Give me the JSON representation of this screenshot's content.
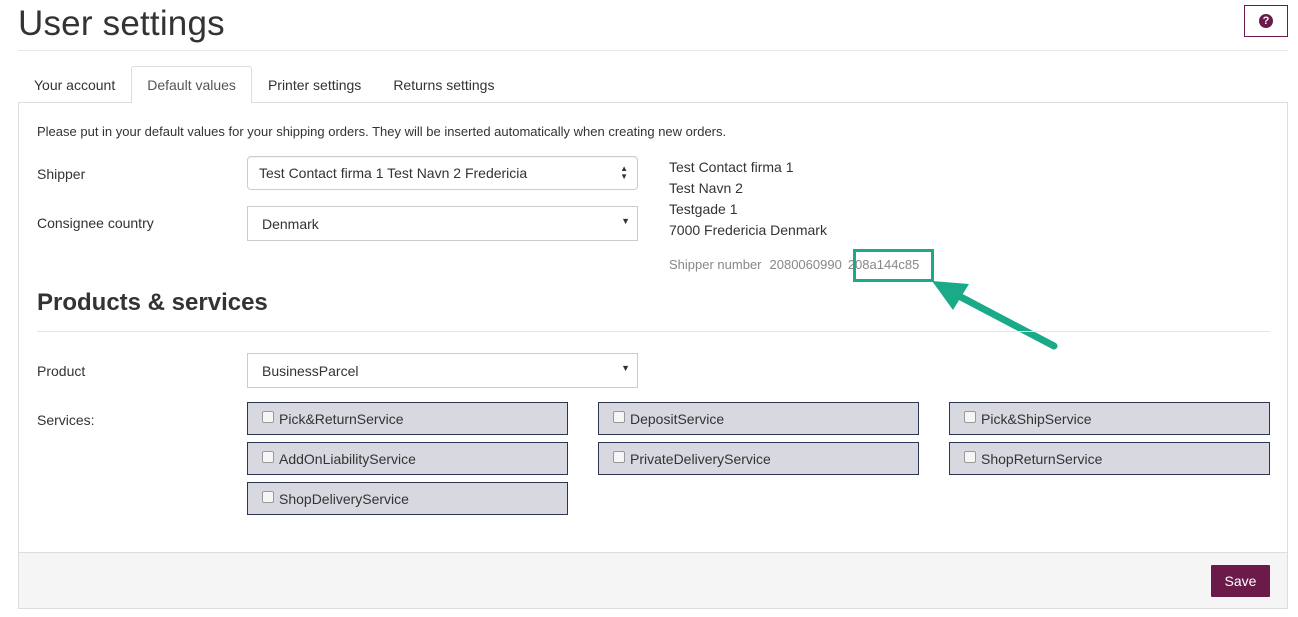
{
  "page": {
    "title": "User settings"
  },
  "help": {
    "icon": "question-circle-icon",
    "glyph": "?"
  },
  "tabs": [
    {
      "label": "Your account",
      "active": false
    },
    {
      "label": "Default values",
      "active": true
    },
    {
      "label": "Printer settings",
      "active": false
    },
    {
      "label": "Returns settings",
      "active": false
    }
  ],
  "intro": "Please put in your default values for your shipping orders. They will be inserted automatically when creating new orders.",
  "shipper": {
    "label": "Shipper",
    "value": "Test Contact firma 1 Test Navn 2 Fredericia",
    "icon": "sort-updown-icon"
  },
  "consignee_country": {
    "label": "Consignee country",
    "value": "Denmark",
    "icon": "caret-down-icon"
  },
  "address": {
    "line1": "Test Contact firma 1",
    "line2": "Test Navn 2",
    "line3": "Testgade 1",
    "line4": "7000 Fredericia Denmark"
  },
  "shipper_number": {
    "label": "Shipper number",
    "prefix": "2080060990",
    "highlighted": "208a144c85",
    "annotation_color": "#1aaa88"
  },
  "products_services": {
    "title": "Products & services",
    "product_label": "Product",
    "product_value": "BusinessParcel",
    "services_label": "Services:",
    "services": [
      {
        "label": "Pick&ReturnService",
        "checked": false
      },
      {
        "label": "DepositService",
        "checked": false
      },
      {
        "label": "Pick&ShipService",
        "checked": false
      },
      {
        "label": "AddOnLiabilityService",
        "checked": false
      },
      {
        "label": "PrivateDeliveryService",
        "checked": false
      },
      {
        "label": "ShopReturnService",
        "checked": false
      },
      {
        "label": "ShopDeliveryService",
        "checked": false
      }
    ]
  },
  "footer": {
    "save_label": "Save"
  },
  "colors": {
    "brand": "#6b1a4a",
    "service_bg": "#d8d9e0",
    "service_border": "#2e3553",
    "annotation": "#1aaa88"
  }
}
